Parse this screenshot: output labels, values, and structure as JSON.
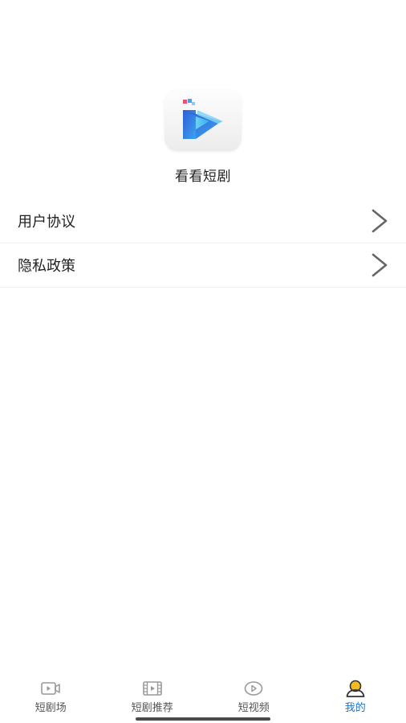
{
  "app": {
    "name": "看看短剧",
    "logo_icon": "play-logo-icon",
    "brand_colors": {
      "primary": "#3b6fe0",
      "secondary": "#42c3f5",
      "accent": "#e8546b"
    }
  },
  "menu": {
    "items": [
      {
        "label": "用户协议",
        "icon": "chevron-right-icon"
      },
      {
        "label": "隐私政策",
        "icon": "chevron-right-icon"
      }
    ]
  },
  "tabbar": {
    "active_color": "#1a73c8",
    "items": [
      {
        "label": "短剧场",
        "icon": "video-camera-icon",
        "active": false
      },
      {
        "label": "短剧推荐",
        "icon": "film-strip-icon",
        "active": false
      },
      {
        "label": "短视频",
        "icon": "play-circle-icon",
        "active": false
      },
      {
        "label": "我的",
        "icon": "user-profile-icon",
        "active": true
      }
    ]
  }
}
